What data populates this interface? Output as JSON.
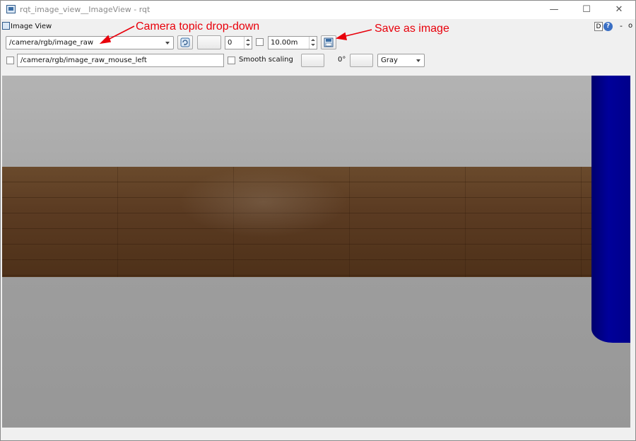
{
  "window": {
    "title": "rqt_image_view__ImageView - rqt",
    "minimize_glyph": "—",
    "maximize_glyph": "☐",
    "close_glyph": "✕"
  },
  "pane": {
    "title": "Image View",
    "d_label": "D",
    "help_label": "?",
    "dash_label": "-",
    "close_label": "o"
  },
  "toolbar": {
    "topic_value": "/camera/rgb/image_raw",
    "num_gridlines_value": "0",
    "max_range_value": "10.00m",
    "mouse_topic_value": "/camera/rgb/image_raw_mouse_left",
    "smooth_scaling_label": "Smooth scaling",
    "rotation_label": "0°",
    "color_scheme_value": "Gray"
  },
  "annotations": {
    "camera_topic_label": "Camera topic drop-down",
    "save_label": "Save as image",
    "color": "#e8000b"
  },
  "icons": [
    "refresh-icon",
    "save-image-icon",
    "chevron-down-icon",
    "help-icon"
  ]
}
